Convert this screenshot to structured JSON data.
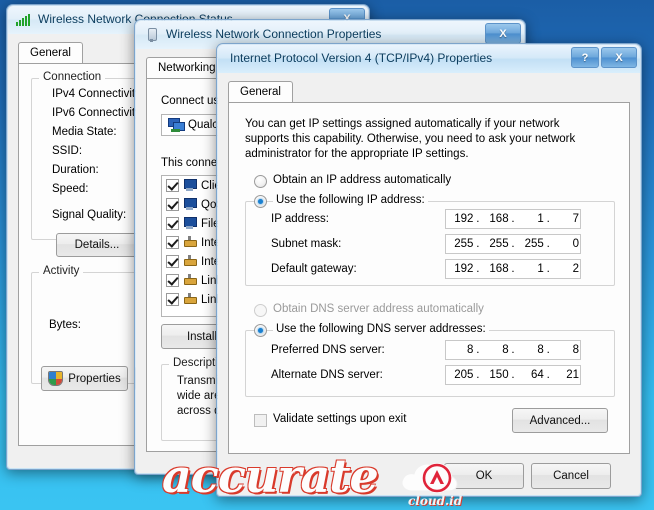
{
  "desktop": {
    "bg_top": "#1b5ea6",
    "bg_bottom": "#3ac4f2"
  },
  "watermark": {
    "text": "accurate",
    "subtext": "cloud.id",
    "accent": "#d93a2b"
  },
  "status_window": {
    "title": "Wireless Network Connection Status",
    "icon": "wifi-signal-icon",
    "close_label": "X",
    "tab": "General",
    "groups": {
      "connection": "Connection",
      "activity": "Activity"
    },
    "fields": [
      "IPv4 Connectivity",
      "IPv6 Connectivity",
      "Media State:",
      "SSID:",
      "Duration:",
      "Speed:",
      "Signal Quality:"
    ],
    "bytes_label": "Bytes:",
    "details_button": "Details...",
    "properties_button": "Properties"
  },
  "properties_window": {
    "title": "Wireless Network Connection Properties",
    "icon": "network-adapter-icon",
    "close_label": "X",
    "tab": "Networking",
    "connect_using_label": "Connect usin",
    "adapter_name": "Qualc",
    "this_connection_label": "This connec",
    "items": [
      {
        "label": "Clie",
        "checked": true,
        "icon": "client-pc-icon"
      },
      {
        "label": "QoS",
        "checked": true,
        "icon": "qos-pc-icon"
      },
      {
        "label": "File",
        "checked": true,
        "icon": "file-sharing-icon"
      },
      {
        "label": "Inte",
        "checked": true,
        "icon": "protocol-plug-icon"
      },
      {
        "label": "Inte",
        "checked": true,
        "icon": "protocol-plug-icon"
      },
      {
        "label": "Link",
        "checked": true,
        "icon": "protocol-plug-icon"
      },
      {
        "label": "Link",
        "checked": true,
        "icon": "protocol-plug-icon"
      }
    ],
    "install_button": "Install",
    "description_label": "Description",
    "description_lines": [
      "Transmiss",
      "wide area",
      "across div"
    ]
  },
  "tcpip_dialog": {
    "title": "Internet Protocol Version 4 (TCP/IPv4) Properties",
    "help_label": "?",
    "close_label": "X",
    "tab": "General",
    "intro": "You can get IP settings assigned automatically if your network supports this capability. Otherwise, you need to ask your network administrator for the appropriate IP settings.",
    "ip_auto_label": "Obtain an IP address automatically",
    "ip_manual_label": "Use the following IP address:",
    "ip_auto_selected": false,
    "ip_manual_selected": true,
    "ip_fields": [
      {
        "label": "IP address:",
        "octets": [
          "192",
          "168",
          "1",
          "7"
        ]
      },
      {
        "label": "Subnet mask:",
        "octets": [
          "255",
          "255",
          "255",
          "0"
        ]
      },
      {
        "label": "Default gateway:",
        "octets": [
          "192",
          "168",
          "1",
          "2"
        ]
      }
    ],
    "dns_auto_label": "Obtain DNS server address automatically",
    "dns_manual_label": "Use the following DNS server addresses:",
    "dns_auto_selected": false,
    "dns_auto_disabled": true,
    "dns_manual_selected": true,
    "dns_fields": [
      {
        "label": "Preferred DNS server:",
        "octets": [
          "8",
          "8",
          "8",
          "8"
        ]
      },
      {
        "label": "Alternate DNS server:",
        "octets": [
          "205",
          "150",
          "64",
          "21"
        ]
      }
    ],
    "validate_label": "Validate settings upon exit",
    "validate_checked": false,
    "advanced_button": "Advanced...",
    "ok_button": "OK",
    "cancel_button": "Cancel"
  }
}
